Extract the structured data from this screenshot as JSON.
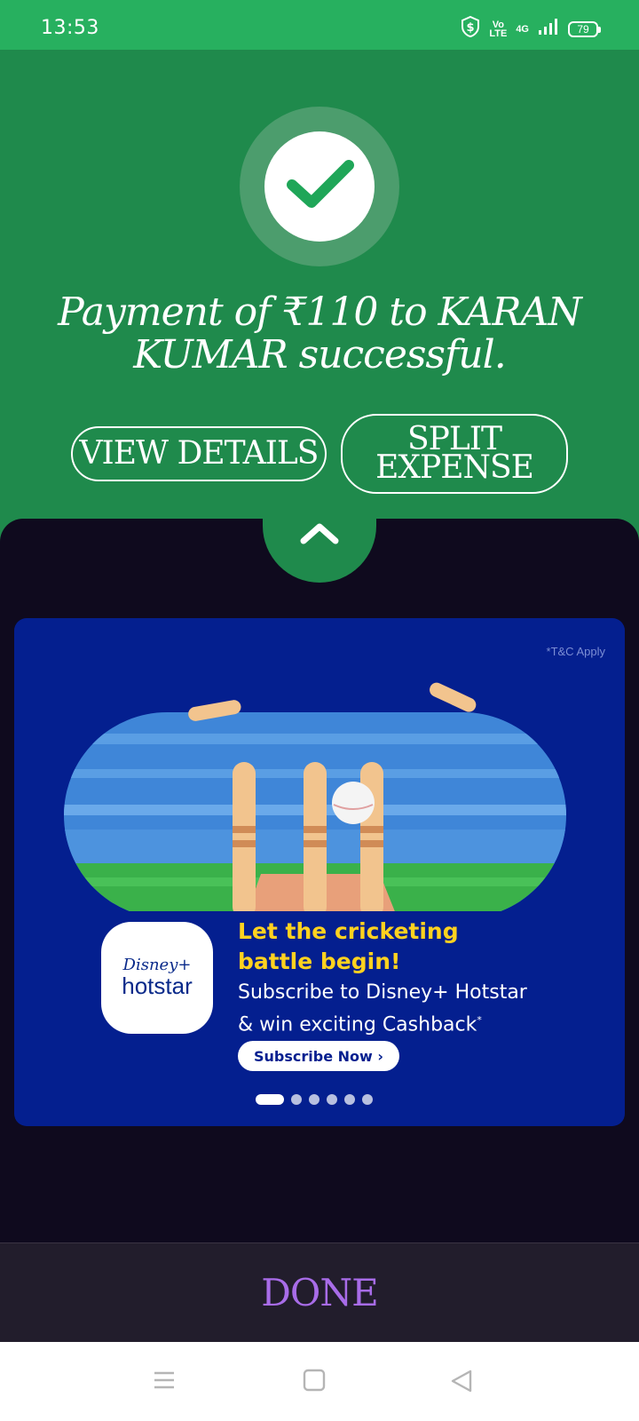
{
  "status_bar": {
    "time": "13:53",
    "network": "4G",
    "volte_top": "Vo",
    "volte_bottom": "LTE",
    "battery": "79"
  },
  "success": {
    "message": "Payment of ₹110 to KARAN KUMAR successful.",
    "view_details_label": "VIEW DETAILS",
    "split_expense_label": "SPLIT EXPENSE"
  },
  "banner": {
    "tnc": "*T&C Apply",
    "logo_top": "Disney+",
    "logo_bottom": "hotstar",
    "headline_line1": "Let the cricketing",
    "headline_line2": "battle begin!",
    "sub_line1": "Subscribe to Disney+ Hotstar",
    "sub_line2": "& win exciting Cashback",
    "sub_mark": "*",
    "cta": "Subscribe Now ›",
    "carousel_total": 6,
    "carousel_active": 1
  },
  "footer": {
    "done_label": "DONE"
  },
  "colors": {
    "status_green": "#27b05f",
    "panel_green": "#1f8a4c",
    "dark_bg": "#0f0a1e",
    "banner_blue": "#041f8f",
    "headline_yellow": "#ffd21f",
    "done_purple": "#a86ce8"
  },
  "icons": [
    "shield-dollar-icon",
    "signal-icon",
    "battery-icon",
    "checkmark-icon",
    "chevron-up-icon",
    "menu-icon",
    "home-square-icon",
    "back-triangle-icon"
  ]
}
